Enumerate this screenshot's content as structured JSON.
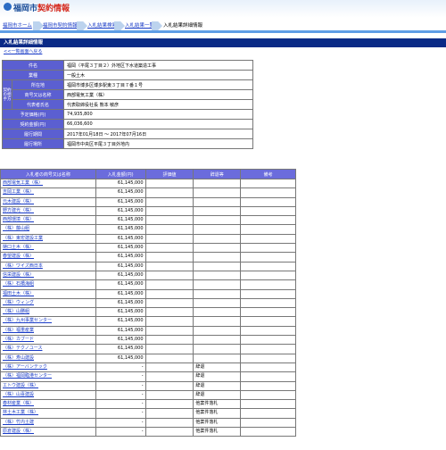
{
  "header": {
    "logo_text": "福岡市",
    "logo_text_red": "契約情報"
  },
  "breadcrumb": [
    "福岡市ホーム",
    "福岡市契約情報",
    "入札結果検索",
    "入札結果一覧",
    "入札結果詳細情報"
  ],
  "page_title": "入札結果詳細情報",
  "back_link": "<<一覧画面へ戻る",
  "info": {
    "item_label": "件名",
    "item_value": "福岡（平尾３丁目２）外地区下水道築造工事",
    "type_label": "業種",
    "type_value": "一般土木",
    "contractor_group": "契約の相手方",
    "address_label": "所在地",
    "address_value": "福岡市博多区博多駅東３丁目７番１号",
    "company_label": "商号又は名称",
    "company_value": "西部電気工業（株）",
    "rep_label": "代表者氏名",
    "rep_value": "代表取締役社長 熊本 敏彦",
    "est_label": "予定価格(円)",
    "est_value": "74,935,800",
    "contract_label": "契約金額(円)",
    "contract_value": "66,036,600",
    "period_label": "履行期間",
    "period_value": "2017年01月18日 〜 2017年07月16日",
    "place_label": "履行場所",
    "place_value": "福岡市中央区平尾３丁目外地内"
  },
  "bids_headers": [
    "入札者の商号又は名称",
    "入札金額(円)",
    "評価値",
    "辞退等",
    "備考"
  ],
  "bids": [
    {
      "name": "西部電気工業（株）",
      "amount": "61,145,000",
      "note": ""
    },
    {
      "name": "吉岡工業（株）",
      "amount": "61,145,000",
      "note": ""
    },
    {
      "name": "元木建設（株）",
      "amount": "61,145,000",
      "note": ""
    },
    {
      "name": "野方建光（株）",
      "amount": "61,145,000",
      "note": ""
    },
    {
      "name": "西部環境（株）",
      "amount": "61,145,000",
      "note": ""
    },
    {
      "name": "（株）藤山組",
      "amount": "61,145,000",
      "note": ""
    },
    {
      "name": "（株）東宏建設工業",
      "amount": "61,145,000",
      "note": ""
    },
    {
      "name": "樋口土木（株）",
      "amount": "61,145,000",
      "note": ""
    },
    {
      "name": "春望建設（株）",
      "amount": "61,145,000",
      "note": ""
    },
    {
      "name": "（株）ワイズ西日本",
      "amount": "61,145,000",
      "note": ""
    },
    {
      "name": "信栄建設（株）",
      "amount": "61,145,000",
      "note": ""
    },
    {
      "name": "（株）石橋海組",
      "amount": "61,145,000",
      "note": ""
    },
    {
      "name": "福田土木（株）",
      "amount": "61,145,000",
      "note": ""
    },
    {
      "name": "（株）ウィング",
      "amount": "61,145,000",
      "note": ""
    },
    {
      "name": "（株）山勝組",
      "amount": "61,145,000",
      "note": ""
    },
    {
      "name": "（株）九州事業センター",
      "amount": "61,145,000",
      "note": ""
    },
    {
      "name": "（株）福重産業",
      "amount": "61,145,000",
      "note": ""
    },
    {
      "name": "（株）カブード",
      "amount": "61,145,000",
      "note": ""
    },
    {
      "name": "（株）テクノユース",
      "amount": "61,145,000",
      "note": ""
    },
    {
      "name": "（株）寿山建設",
      "amount": "61,145,000",
      "note": ""
    },
    {
      "name": "（株）アーバンテック",
      "amount": "-",
      "note": "辞退"
    },
    {
      "name": "（株）福岡臨港センター",
      "amount": "-",
      "note": "辞退"
    },
    {
      "name": "エトウ建設（株）",
      "amount": "-",
      "note": "辞退"
    },
    {
      "name": "（株）山喜建設",
      "amount": "-",
      "note": "辞退"
    },
    {
      "name": "春材産業（株）",
      "amount": "-",
      "note": "他案件落札"
    },
    {
      "name": "林土木工業（株）",
      "amount": "-",
      "note": "他案件落札"
    },
    {
      "name": "（株）竹内土建",
      "amount": "-",
      "note": "他案件落札"
    },
    {
      "name": "原倉建設（株）",
      "amount": "-",
      "note": "他案件落札"
    }
  ]
}
